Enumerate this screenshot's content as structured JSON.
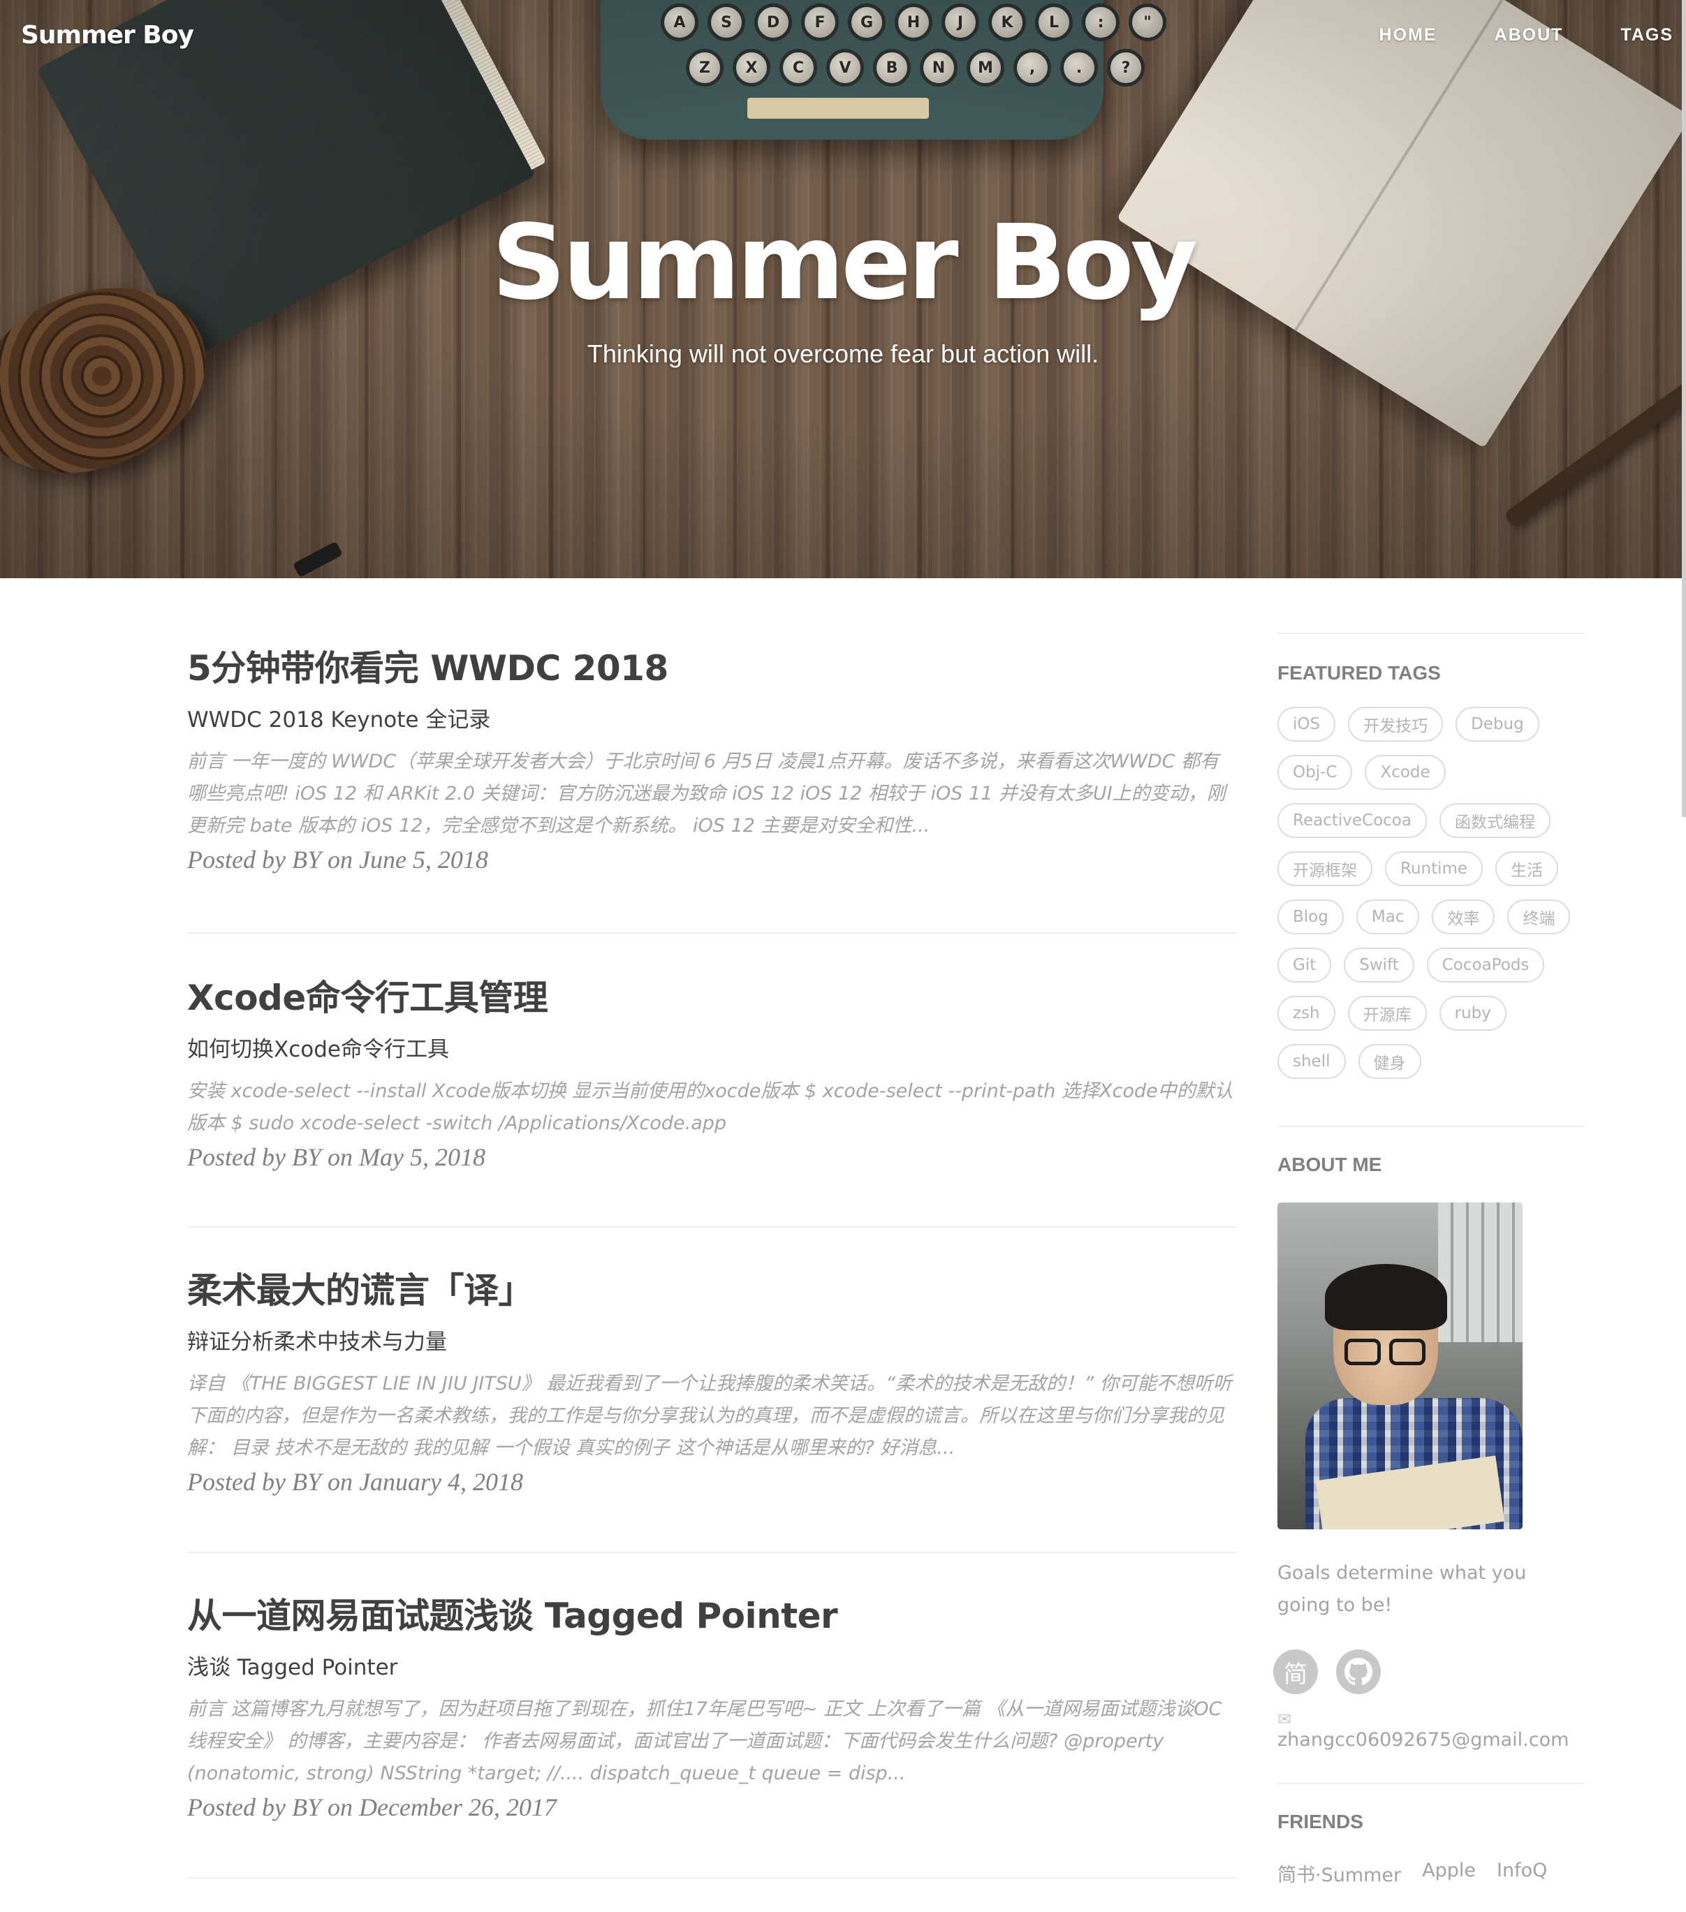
{
  "site": {
    "brand": "Summer Boy",
    "nav": [
      "HOME",
      "ABOUT",
      "TAGS"
    ],
    "hero_title": "Summer Boy",
    "hero_subtitle": "Thinking will not overcome fear but action will."
  },
  "typewriter_keys": {
    "row1": [
      "A",
      "S",
      "D",
      "F",
      "G",
      "H",
      "J",
      "K",
      "L",
      ":",
      "\""
    ],
    "row2": [
      "Z",
      "X",
      "C",
      "V",
      "B",
      "N",
      "M",
      ",",
      ".",
      "?"
    ]
  },
  "posts": [
    {
      "title": "5分钟带你看完 WWDC 2018",
      "subtitle": "WWDC 2018 Keynote 全记录",
      "excerpt": "前言 一年一度的 WWDC（苹果全球开发者大会）于北京时间 6 月5日 凌晨1点开幕。废话不多说，来看看这次WWDC 都有哪些亮点吧! iOS 12 和 ARKit 2.0 关键词：官方防沉迷最为致命 iOS 12 iOS 12 相较于 iOS 11 并没有太多UI上的变动，刚更新完 bate 版本的 iOS 12，完全感觉不到这是个新系统。 iOS 12 主要是对安全和性...",
      "meta": "Posted by BY on June 5, 2018"
    },
    {
      "title": "Xcode命令行工具管理",
      "subtitle": "如何切换Xcode命令行工具",
      "excerpt": "安装 xcode-select --install Xcode版本切换 显示当前使用的xocde版本 $ xcode-select --print-path 选择Xcode中的默认版本 $ sudo xcode-select -switch /Applications/Xcode.app",
      "meta": "Posted by BY on May 5, 2018"
    },
    {
      "title": "柔术最大的谎言「译」",
      "subtitle": "辩证分析柔术中技术与力量",
      "excerpt": "译自 《THE BIGGEST LIE IN JIU JITSU》 最近我看到了一个让我捧腹的柔术笑话。“柔术的技术是无敌的！” 你可能不想听听下面的内容，但是作为一名柔术教练，我的工作是与你分享我认为的真理，而不是虚假的谎言。所以在这里与你们分享我的见解： 目录 技术不是无敌的 我的见解 一个假设 真实的例子 这个神话是从哪里来的? 好消息...",
      "meta": "Posted by BY on January 4, 2018"
    },
    {
      "title": "从一道网易面试题浅谈 Tagged Pointer",
      "subtitle": "浅谈 Tagged Pointer",
      "excerpt": "前言 这篇博客九月就想写了，因为赶项目拖了到现在，抓住17年尾巴写吧~ 正文 上次看了一篇 《从一道网易面试题浅谈OC线程安全》 的博客，主要内容是： 作者去网易面试，面试官出了一道面试题：下面代码会发生什么问题? @property (nonatomic, strong) NSString *target; //.... dispatch_queue_t queue = disp...",
      "meta": "Posted by BY on December 26, 2017"
    }
  ],
  "sidebar": {
    "featured_heading": "FEATURED TAGS",
    "tags": [
      "iOS",
      "开发技巧",
      "Debug",
      "Obj-C",
      "Xcode",
      "ReactiveCocoa",
      "函数式编程",
      "开源框架",
      "Runtime",
      "生活",
      "Blog",
      "Mac",
      "效率",
      "终端",
      "Git",
      "Swift",
      "CocoaPods",
      "zsh",
      "开源库",
      "ruby",
      "shell",
      "健身"
    ],
    "about_heading": "ABOUT ME",
    "about_text": "Goals determine what you going to be!",
    "social_jianshu": "简",
    "social_github": "⌾",
    "email": "zhangcc06092675@gmail.com",
    "friends_heading": "FRIENDS",
    "friends": [
      "简书·Summer",
      "Apple",
      "InfoQ"
    ]
  },
  "colors": {
    "text": "#404040",
    "muted": "#a3a3a3",
    "meta": "#808080",
    "tag_border": "#dcdcdc",
    "hero_overlay": "rgba(0,0,0,0.22)"
  }
}
